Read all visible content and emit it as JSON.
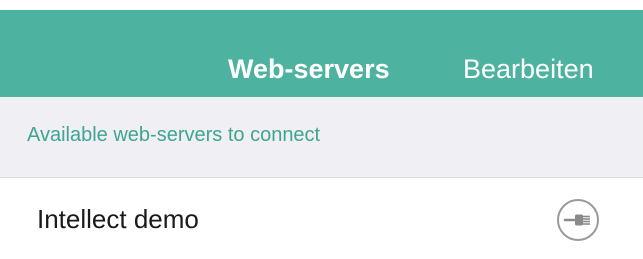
{
  "nav": {
    "title": "Web-servers",
    "edit_label": "Bearbeiten",
    "bar_color": "#4db3a0"
  },
  "section": {
    "header": "Available web-servers to connect",
    "header_color": "#3fa592"
  },
  "servers": [
    {
      "name": "Intellect demo",
      "action_icon": "plug-connect-icon"
    }
  ]
}
